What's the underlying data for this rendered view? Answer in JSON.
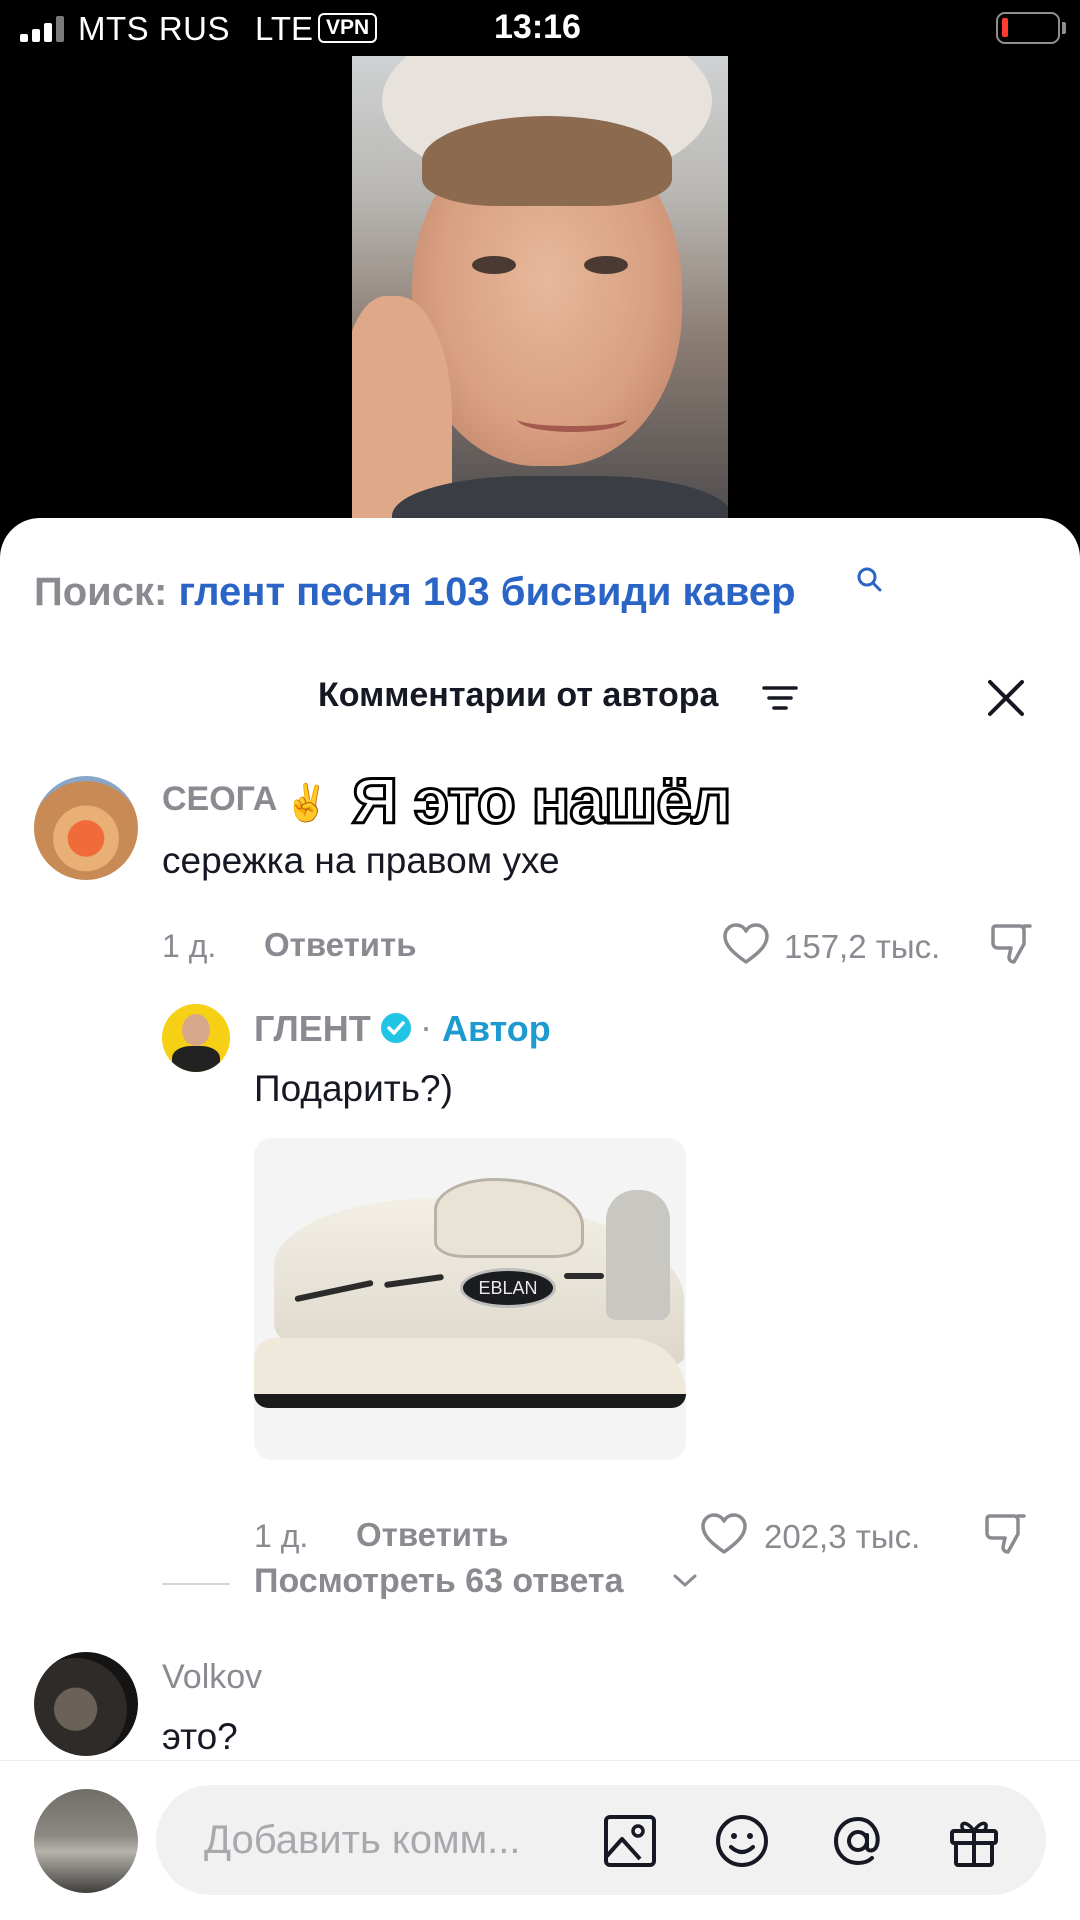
{
  "status_bar": {
    "carrier": "MTS RUS",
    "network": "LTE",
    "vpn": "VPN",
    "time": "13:16"
  },
  "search": {
    "label": "Поиск:",
    "query": "глент песня 103 бисвиди кавер"
  },
  "sheet": {
    "title": "Комментарии от автора"
  },
  "overlay_text": "Я это нашёл",
  "comments": [
    {
      "username": "СЕОГА",
      "emoji": "✌️",
      "text": "сережка на правом ухе",
      "time": "1 д.",
      "reply_label": "Ответить",
      "likes": "157,2 тыс."
    },
    {
      "username": "ГЛЕНТ",
      "author_badge": "Автор",
      "separator": "·",
      "text": "Подарить?)",
      "image_label": "EBLAN",
      "time": "1 д.",
      "reply_label": "Ответить",
      "likes": "202,3 тыс."
    },
    {
      "username": "Volkov",
      "text": "это?"
    }
  ],
  "view_replies": "Посмотреть 63 ответа",
  "input": {
    "placeholder": "Добавить комм..."
  },
  "colors": {
    "accent_blue": "#2a64c5",
    "author_blue": "#1d9bd1",
    "muted": "#8a8b91",
    "battery_low": "#ff3b30"
  },
  "icons": [
    "search-icon",
    "filter-icon",
    "close-icon",
    "heart-icon",
    "dislike-icon",
    "verified-icon",
    "chevron-down-icon",
    "image-icon",
    "emoji-icon",
    "mention-icon",
    "gift-icon"
  ]
}
